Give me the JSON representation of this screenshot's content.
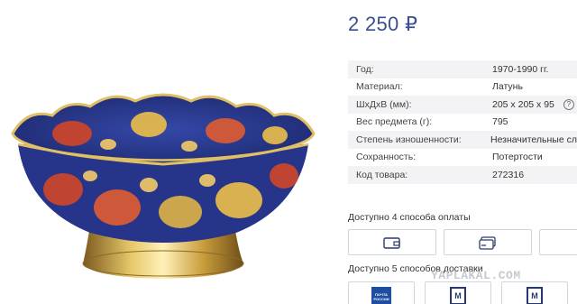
{
  "product": {
    "price": "2 250 ₽",
    "image_alt": "brass enamel bowl photo"
  },
  "specs": [
    {
      "label": "Год:",
      "value": "1970-1990 гг."
    },
    {
      "label": "Материал:",
      "value": "Латунь"
    },
    {
      "label": "ШхДхВ (мм):",
      "value": "205 х 205 х 95",
      "help": "?"
    },
    {
      "label": "Вес предмета (г):",
      "value": "795"
    },
    {
      "label": "Степень изношенности:",
      "value": "Незначительные сл"
    },
    {
      "label": "Сохранность:",
      "value": "Потертости"
    },
    {
      "label": "Код товара:",
      "value": "272316"
    }
  ],
  "payment": {
    "title": "Доступно 4 способа оплаты",
    "icons": [
      "wallet-icon",
      "card-icon",
      "phone-icon"
    ]
  },
  "delivery": {
    "title": "Доступно 5 способов доставки",
    "post_logo": "ПОЧТА РОССИИ",
    "ems_logo": "М"
  },
  "watermark": "YAPLAKAL.COM",
  "colors": {
    "price": "#3a4f8f",
    "bowl_blue": "#2b3a8c",
    "bowl_red": "#c9452e",
    "bowl_gold": "#d4ad4a",
    "border": "#d0d5de"
  }
}
